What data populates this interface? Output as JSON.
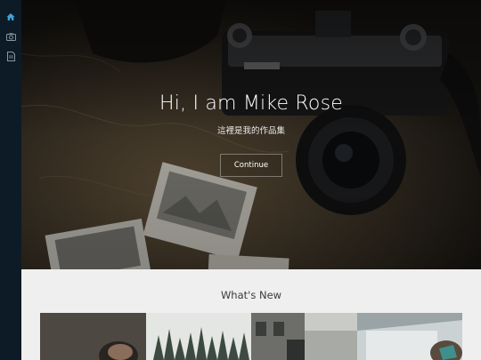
{
  "sidebar": {
    "items": [
      {
        "icon": "home-icon",
        "active": true
      },
      {
        "icon": "camera-icon",
        "active": false
      },
      {
        "icon": "document-icon",
        "active": false
      }
    ]
  },
  "hero": {
    "title": "Hi, I am Mike Rose",
    "subtitle": "這裡是我的作品集",
    "button_label": "Continue"
  },
  "news": {
    "title": "What's New",
    "thumbnails": [
      "portrait-photo",
      "forest-photo",
      "street-photo",
      "car-window-photo"
    ]
  },
  "colors": {
    "sidebar_bg": "#0d1b26",
    "accent": "#3ea3dc",
    "section_bg": "#efefef"
  }
}
